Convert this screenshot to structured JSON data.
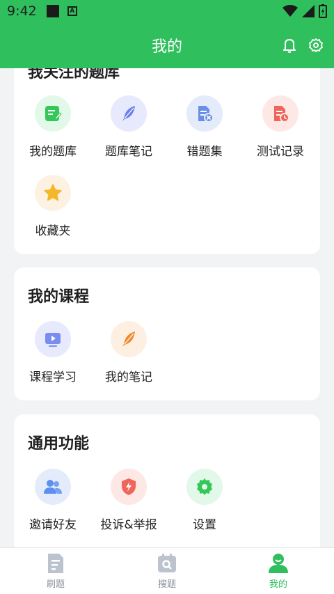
{
  "status_bar": {
    "time": "9:42"
  },
  "header": {
    "title": "我的"
  },
  "section_favorites": {
    "title": "我关注的题库",
    "items": [
      {
        "label": "我的题库",
        "icon": "question-bank-icon",
        "bg": "#e2f8e8",
        "color": "#34c759"
      },
      {
        "label": "题库笔记",
        "icon": "feather-icon",
        "bg": "#e6eafc",
        "color": "#6d7ff0"
      },
      {
        "label": "错题集",
        "icon": "wrong-questions-icon",
        "bg": "#e4ecfb",
        "color": "#6a8fe8"
      },
      {
        "label": "测试记录",
        "icon": "test-record-icon",
        "bg": "#fde8e6",
        "color": "#f0655a"
      },
      {
        "label": "收藏夹",
        "icon": "star-icon",
        "bg": "#fdf2e2",
        "color": "#f5b62a"
      }
    ]
  },
  "section_courses": {
    "title": "我的课程",
    "items": [
      {
        "label": "课程学习",
        "icon": "video-icon",
        "bg": "#e6eafc",
        "color": "#7b8cf0"
      },
      {
        "label": "我的笔记",
        "icon": "notes-feather-icon",
        "bg": "#fdf0e2",
        "color": "#f08a2e"
      }
    ]
  },
  "section_general": {
    "title": "通用功能",
    "items": [
      {
        "label": "邀请好友",
        "icon": "invite-users-icon",
        "bg": "#e4ecfb",
        "color": "#5b8ff0"
      },
      {
        "label": "投诉&举报",
        "icon": "report-icon",
        "bg": "#fde8e6",
        "color": "#f0655a"
      },
      {
        "label": "设置",
        "icon": "gear-icon",
        "bg": "#e2f8e8",
        "color": "#34c759"
      }
    ]
  },
  "tabbar": {
    "tabs": [
      {
        "label": "刷题",
        "icon": "practice-icon"
      },
      {
        "label": "搜题",
        "icon": "search-question-icon"
      },
      {
        "label": "我的",
        "icon": "profile-icon",
        "active": true
      }
    ]
  },
  "colors": {
    "brand": "#2fbf5d",
    "background": "#f2f3f5"
  }
}
